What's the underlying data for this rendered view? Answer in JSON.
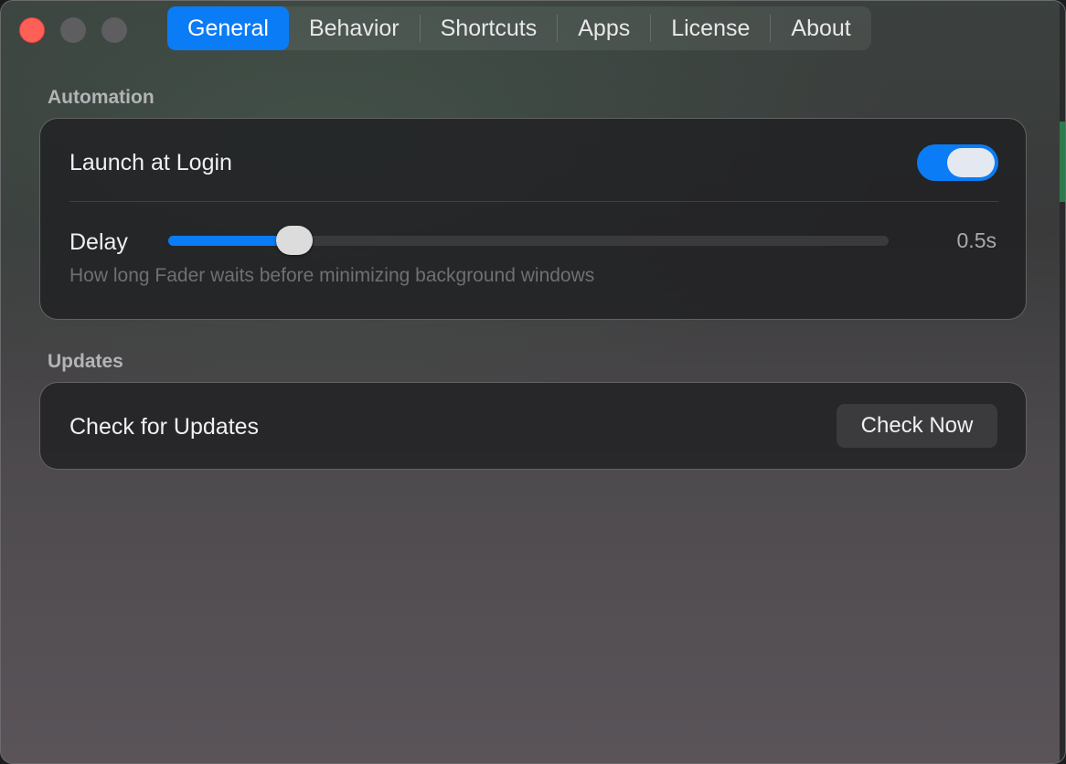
{
  "tabs": [
    {
      "label": "General",
      "active": true
    },
    {
      "label": "Behavior",
      "active": false
    },
    {
      "label": "Shortcuts",
      "active": false
    },
    {
      "label": "Apps",
      "active": false
    },
    {
      "label": "License",
      "active": false
    },
    {
      "label": "About",
      "active": false
    }
  ],
  "automation": {
    "title": "Automation",
    "launch_at_login": {
      "label": "Launch at Login",
      "enabled": true
    },
    "delay": {
      "label": "Delay",
      "value_text": "0.5s",
      "fraction": 0.175,
      "hint": "How long Fader waits before minimizing background windows"
    }
  },
  "updates": {
    "title": "Updates",
    "check_label": "Check for Updates",
    "button_label": "Check Now"
  },
  "colors": {
    "accent": "#0a7cf6",
    "close": "#fe5f57"
  }
}
